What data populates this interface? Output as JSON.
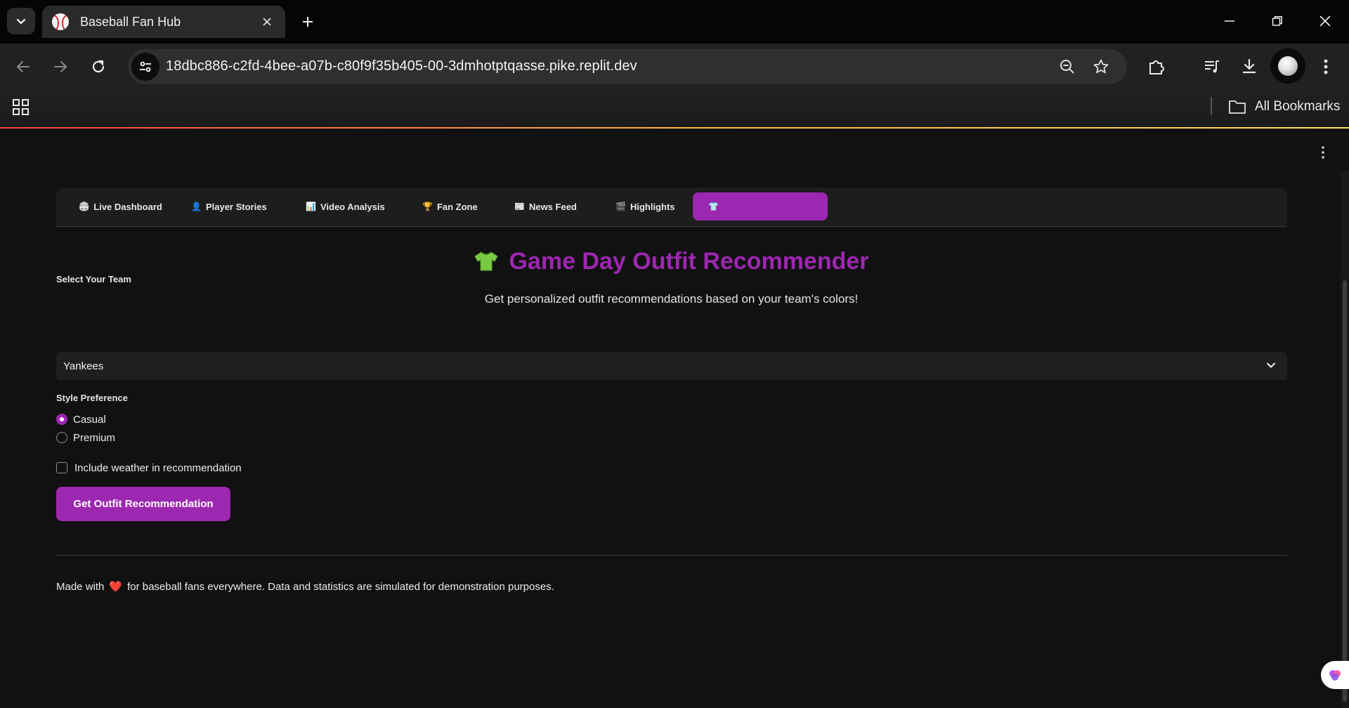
{
  "browser": {
    "tab_title": "Baseball Fan Hub",
    "url": "18dbc886-c2fd-4bee-a07b-c80f9f35b405-00-3dmhotptqasse.pike.replit.dev",
    "bookmarks_label": "All Bookmarks"
  },
  "app": {
    "tabs": [
      {
        "icon": "🏟",
        "label": "Live Dashboard"
      },
      {
        "icon": "👤",
        "label": "Player Stories"
      },
      {
        "icon": "📊",
        "label": "Video Analysis"
      },
      {
        "icon": "🏆",
        "label": "Fan Zone"
      },
      {
        "icon": "📰",
        "label": "News Feed"
      },
      {
        "icon": "🎬",
        "label": "Highlights"
      },
      {
        "icon": "👕",
        "label": ""
      }
    ],
    "active_tab_index": 6,
    "title": "Game Day Outfit Recommender",
    "subtitle": "Get personalized outfit recommendations based on your team's colors!",
    "team_select": {
      "label": "Select Your Team",
      "value": "Yankees"
    },
    "style_preference": {
      "label": "Style Preference",
      "options": [
        "Casual",
        "Premium"
      ],
      "selected": "Casual"
    },
    "weather_checkbox": {
      "label": "Include weather in recommendation",
      "checked": false
    },
    "submit_label": "Get Outfit Recommendation",
    "footer": {
      "prefix": "Made with",
      "heart": "❤️",
      "suffix": "for baseball fans everywhere. Data and statistics are simulated for demonstration purposes."
    }
  },
  "colors": {
    "accent": "#9c27b0",
    "background": "#111111",
    "shirt_icon": "#7ac943"
  }
}
